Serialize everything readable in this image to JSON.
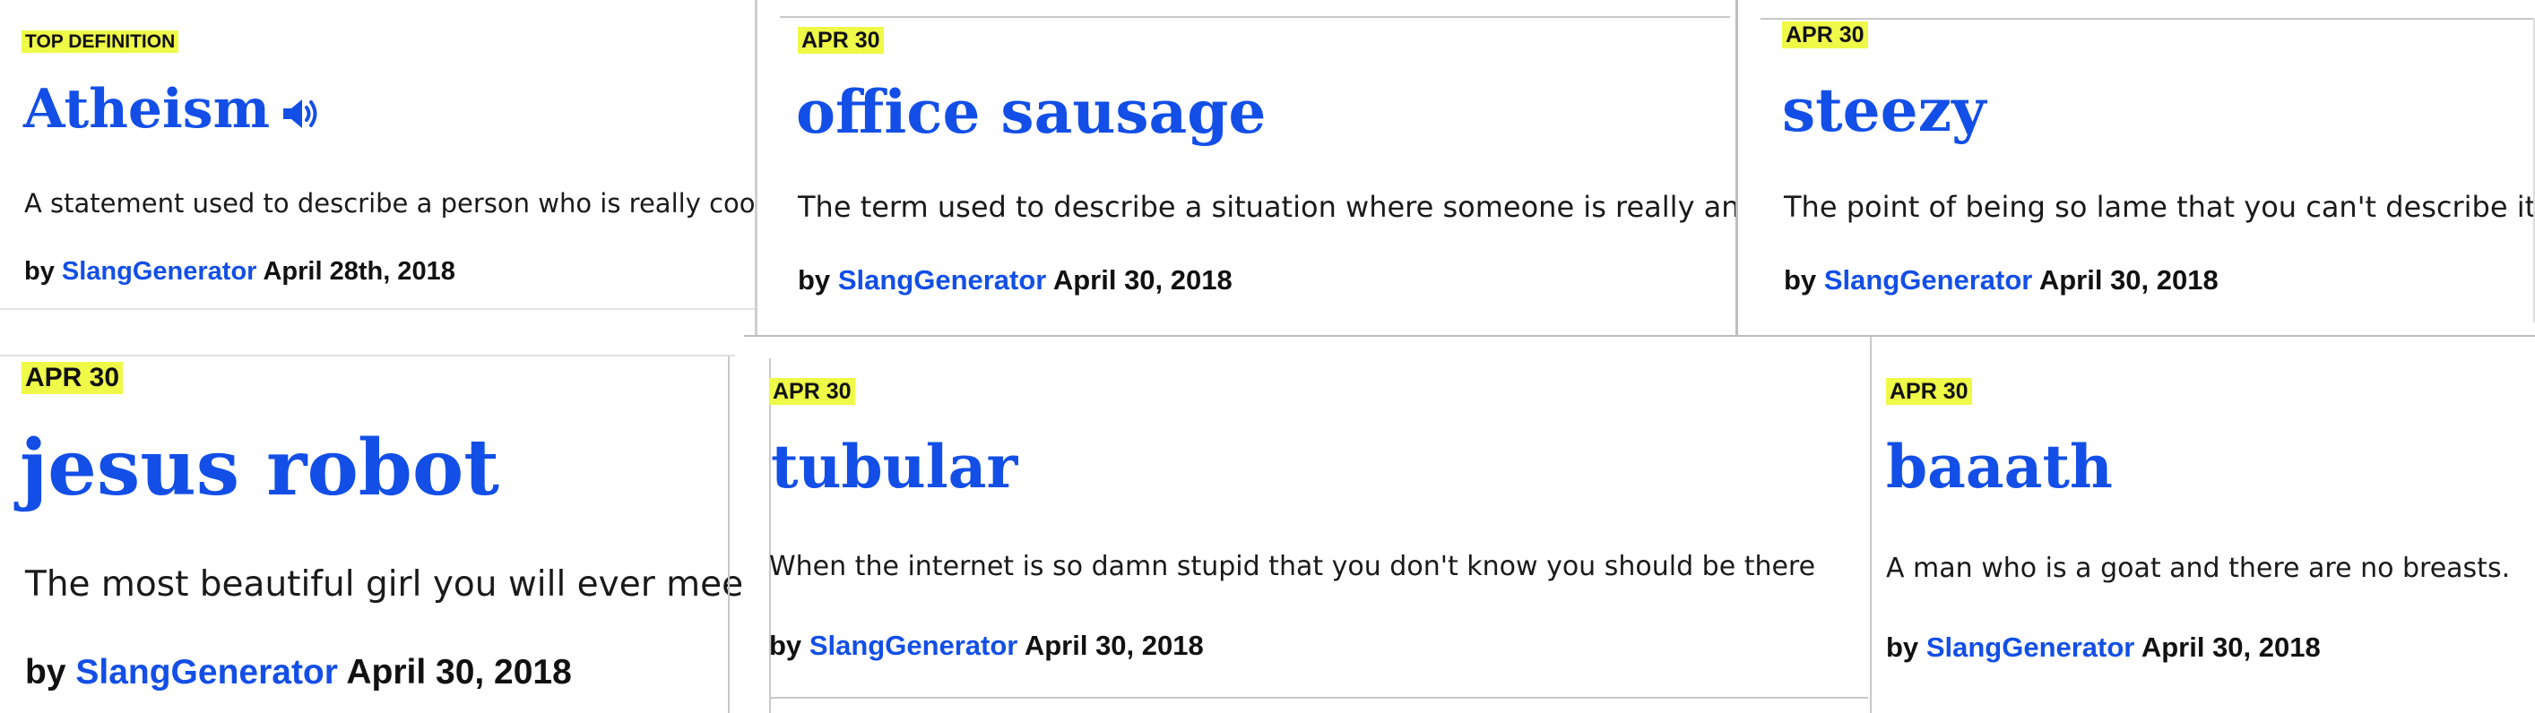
{
  "definitions": [
    {
      "badge": "TOP DEFINITION",
      "word": "Atheism",
      "meaning": "A statement used to describe a person who is really cool.",
      "by": "by",
      "author": "SlangGenerator",
      "date": "April 28th, 2018",
      "icon": "speaker-icon"
    },
    {
      "badge": "APR 30",
      "word": "office sausage",
      "meaning": "The term used to describe a situation where someone is really angry.",
      "by": "by",
      "author": "SlangGenerator",
      "date": "April 30, 2018"
    },
    {
      "badge": "APR 30",
      "word": "steezy",
      "meaning": "The point of being so lame that you can't describe it.",
      "by": "by",
      "author": "SlangGenerator",
      "date": "April 30, 2018"
    },
    {
      "badge": "APR 30",
      "word": "jesus robot",
      "meaning": "The most beautiful girl you will ever meet.",
      "by": "by",
      "author": "SlangGenerator",
      "date": "April 30, 2018"
    },
    {
      "badge": "APR 30",
      "word": "tubular",
      "meaning": "When the internet is so damn stupid that you don't know you should be there",
      "by": "by",
      "author": "SlangGenerator",
      "date": "April 30, 2018"
    },
    {
      "badge": "APR 30",
      "word": "baaath",
      "meaning": "A man who is a goat and there are no breasts.",
      "by": "by",
      "author": "SlangGenerator",
      "date": "April 30, 2018"
    }
  ],
  "colors": {
    "word": "#134fe6",
    "badge_bg": "#eff947",
    "text": "#1a1a1a",
    "border": "#c8c8c8"
  }
}
